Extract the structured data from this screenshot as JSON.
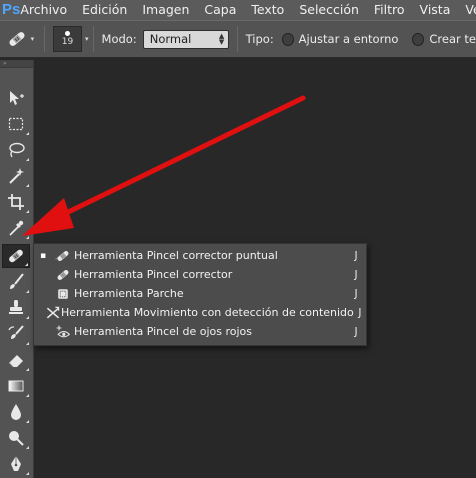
{
  "app": {
    "logo": "Ps"
  },
  "menubar": {
    "items": [
      "Archivo",
      "Edición",
      "Imagen",
      "Capa",
      "Texto",
      "Selección",
      "Filtro",
      "Vista",
      "Ve"
    ]
  },
  "options": {
    "brush_size": "19",
    "mode_label": "Modo:",
    "mode_value": "Normal",
    "type_label": "Tipo:",
    "radio1": "Ajustar a entorno",
    "radio2": "Crear te"
  },
  "toolbar": {
    "grip": "»",
    "tools": [
      "move-tool",
      "marquee-tool",
      "lasso-tool",
      "quick-selection-tool",
      "crop-tool",
      "eyedropper-tool",
      "healing-brush-tool",
      "brush-tool",
      "clone-stamp-tool",
      "history-brush-tool",
      "eraser-tool",
      "gradient-tool",
      "blur-tool",
      "dodge-tool",
      "pen-tool"
    ]
  },
  "flyout": {
    "items": [
      {
        "label": "Herramienta Pincel corrector puntual",
        "key": "J",
        "selected": "▪",
        "icon": "spot-healing-icon"
      },
      {
        "label": "Herramienta Pincel corrector",
        "key": "J",
        "selected": "",
        "icon": "healing-brush-icon"
      },
      {
        "label": "Herramienta Parche",
        "key": "J",
        "selected": "",
        "icon": "patch-icon"
      },
      {
        "label": "Herramienta Movimiento con detección de contenido",
        "key": "J",
        "selected": "",
        "icon": "content-aware-move-icon"
      },
      {
        "label": "Herramienta Pincel de ojos rojos",
        "key": "J",
        "selected": "",
        "icon": "red-eye-icon"
      }
    ]
  },
  "colors": {
    "arrow": "#e01010",
    "menubar": "#5b5b5b",
    "panel": "#535353",
    "canvas": "#282828",
    "ps_logo": "#4ea6ff"
  }
}
